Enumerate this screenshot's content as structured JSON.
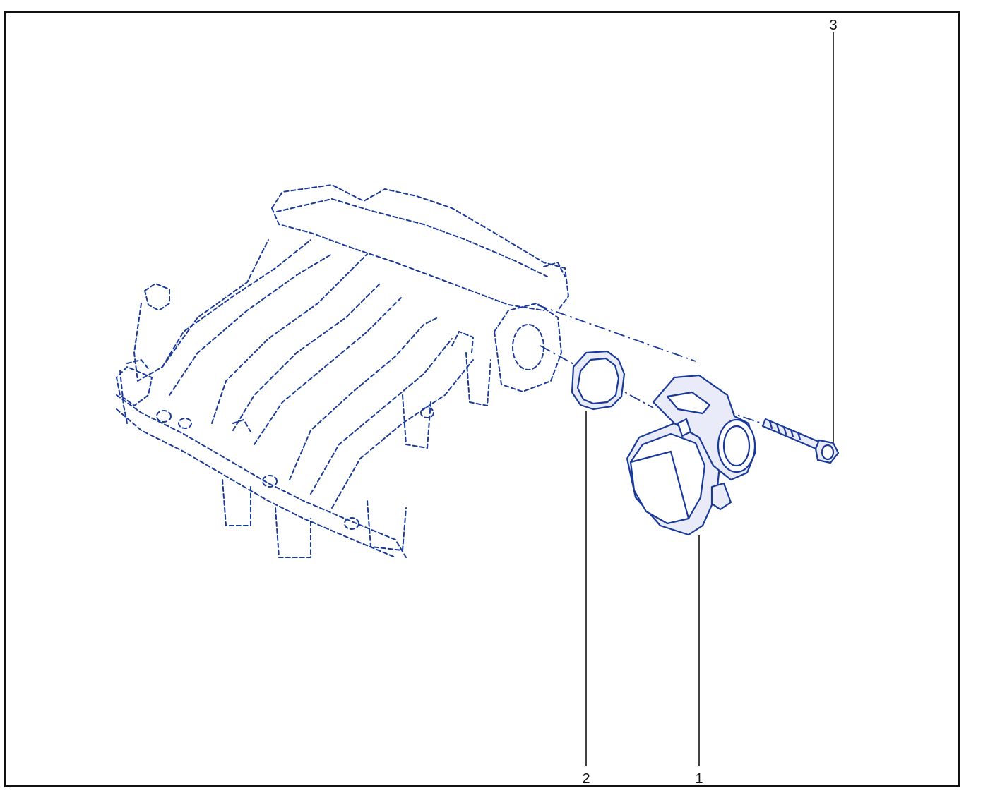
{
  "diagram": {
    "callouts": [
      {
        "id": "1",
        "label": "1"
      },
      {
        "id": "2",
        "label": "2"
      },
      {
        "id": "3",
        "label": "3"
      }
    ],
    "colors": {
      "line": "#1a3a9a",
      "fill": "#e9ecf8",
      "leader": "#111111",
      "border": "#111111"
    }
  }
}
